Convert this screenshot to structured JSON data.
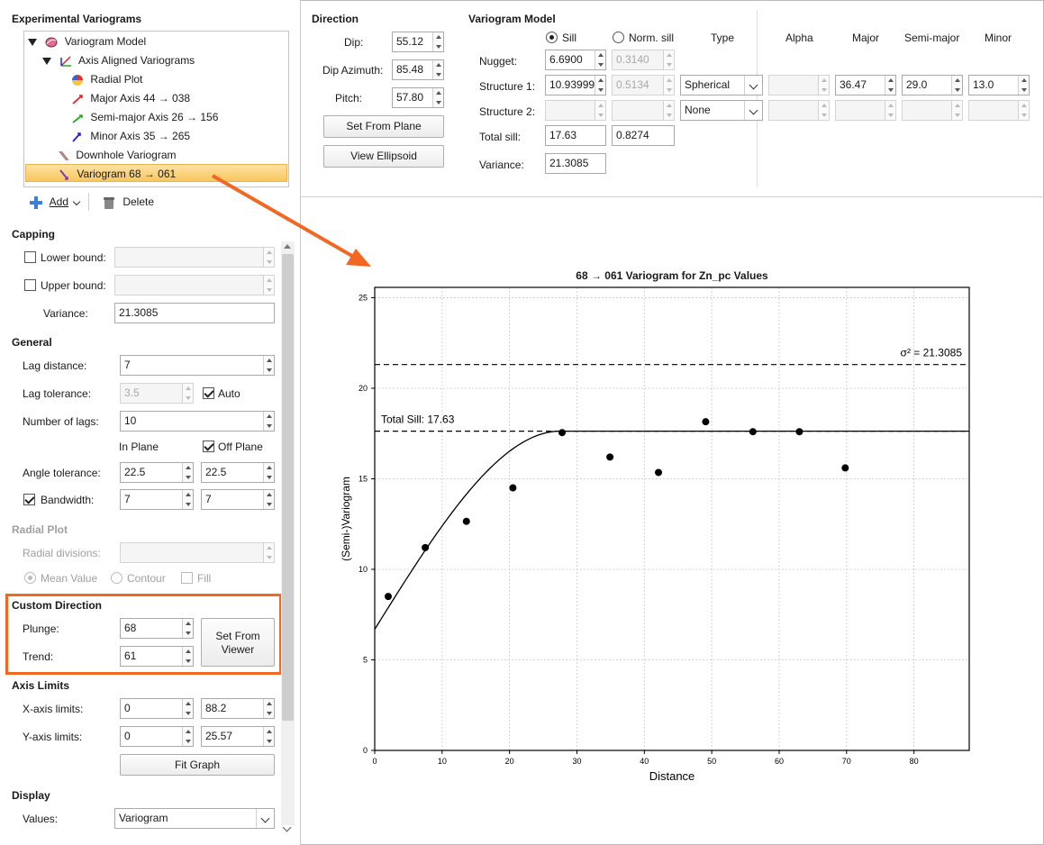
{
  "tree": {
    "title": "Experimental Variograms",
    "items": [
      {
        "label": "Variogram Model"
      },
      {
        "label": "Axis Aligned Variograms"
      },
      {
        "label": "Radial Plot"
      },
      {
        "label": "Major Axis 44 → 038"
      },
      {
        "label": "Semi-major Axis 26 → 156"
      },
      {
        "label": "Minor Axis 35 → 265"
      },
      {
        "label": "Downhole Variogram"
      },
      {
        "label": "Variogram 68 → 061"
      }
    ],
    "add_label": "Add",
    "delete_label": "Delete"
  },
  "capping": {
    "title": "Capping",
    "lower_bound_label": "Lower bound:",
    "upper_bound_label": "Upper bound:",
    "variance_label": "Variance:",
    "variance_value": "21.3085"
  },
  "general": {
    "title": "General",
    "lag_distance_label": "Lag distance:",
    "lag_distance_value": "7",
    "lag_tolerance_label": "Lag tolerance:",
    "lag_tolerance_value": "3.5",
    "auto_label": "Auto",
    "num_lags_label": "Number of lags:",
    "num_lags_value": "10",
    "in_plane_label": "In Plane",
    "off_plane_label": "Off Plane",
    "angle_tolerance_label": "Angle tolerance:",
    "angle_tolerance_in": "22.5",
    "angle_tolerance_off": "22.5",
    "bandwidth_label": "Bandwidth:",
    "bandwidth_in": "7",
    "bandwidth_off": "7"
  },
  "radial": {
    "title": "Radial Plot",
    "divisions_label": "Radial divisions:",
    "mean_label": "Mean Value",
    "contour_label": "Contour",
    "fill_label": "Fill"
  },
  "custom": {
    "title": "Custom Direction",
    "plunge_label": "Plunge:",
    "plunge_value": "68",
    "trend_label": "Trend:",
    "trend_value": "61",
    "set_from_viewer_1": "Set From",
    "set_from_viewer_2": "Viewer"
  },
  "axis_limits": {
    "title": "Axis Limits",
    "x_label": "X-axis limits:",
    "x_min": "0",
    "x_max": "88.2",
    "y_label": "Y-axis limits:",
    "y_min": "0",
    "y_max": "25.57",
    "fit_graph": "Fit Graph"
  },
  "display": {
    "title": "Display",
    "values_label": "Values:",
    "values_value": "Variogram"
  },
  "direction": {
    "title": "Direction",
    "dip_label": "Dip:",
    "dip_value": "55.12",
    "dip_azimuth_label": "Dip Azimuth:",
    "dip_azimuth_value": "85.48",
    "pitch_label": "Pitch:",
    "pitch_value": "57.80",
    "set_from_plane": "Set From Plane",
    "view_ellipsoid": "View Ellipsoid"
  },
  "model": {
    "title": "Variogram Model",
    "sill_label": "Sill",
    "norm_sill_label": "Norm. sill",
    "col_type": "Type",
    "col_alpha": "Alpha",
    "col_major": "Major",
    "col_semi_major": "Semi-major",
    "col_minor": "Minor",
    "nugget_label": "Nugget:",
    "nugget_sill": "6.6900",
    "nugget_norm": "0.3140",
    "structure1_label": "Structure 1:",
    "s1_sill": "10.939999",
    "s1_norm": "0.5134",
    "s1_type": "Spherical",
    "s1_major": "36.47",
    "s1_semi_major": "29.0",
    "s1_minor": "13.0",
    "structure2_label": "Structure 2:",
    "s2_type": "None",
    "total_sill_label": "Total sill:",
    "total_sill": "17.63",
    "total_norm": "0.8274",
    "variance_label": "Variance:",
    "variance_value": "21.3085"
  },
  "colors": {
    "accent_orange": "#f26722",
    "selection": "#f8c65f"
  },
  "chart_data": {
    "type": "scatter",
    "title": "68 → 061 Variogram for Zn_pc Values",
    "xlabel": "Distance",
    "ylabel": "(Semi-)Variogram",
    "xlim": [
      0,
      88.2
    ],
    "ylim": [
      0,
      25.57
    ],
    "xticks": [
      0,
      10,
      20,
      30,
      40,
      50,
      60,
      70,
      80
    ],
    "yticks": [
      0,
      5,
      10,
      15,
      20,
      25
    ],
    "grid": true,
    "points": {
      "x": [
        2.0,
        7.5,
        13.6,
        20.5,
        27.8,
        34.9,
        42.1,
        49.1,
        56.1,
        63.0,
        69.8
      ],
      "y": [
        8.5,
        11.2,
        12.65,
        14.5,
        17.55,
        16.2,
        15.35,
        18.15,
        17.6,
        17.6,
        15.6
      ]
    },
    "model": {
      "nugget": 6.69,
      "structure_sill": 10.94,
      "range": 27.5,
      "type": "spherical"
    },
    "reference_lines": [
      {
        "y": 21.3085,
        "label": "σ² = 21.3085"
      },
      {
        "y": 17.63,
        "label": "Total Sill: 17.63"
      }
    ]
  }
}
